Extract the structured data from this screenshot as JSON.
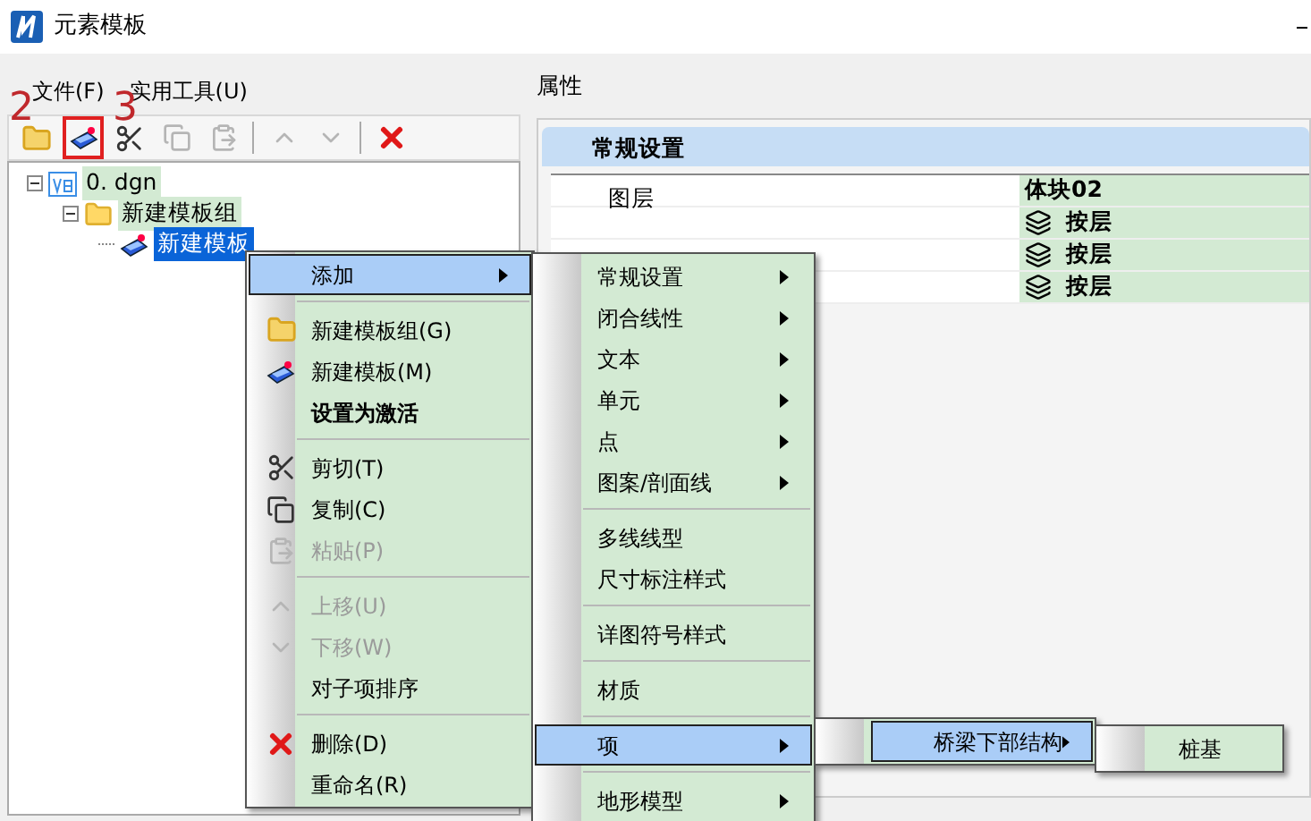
{
  "window": {
    "title": "元素模板"
  },
  "menu_bar": [
    "文件(F)",
    "实用工具(U)"
  ],
  "toolbar": [
    {
      "kind": "folder-add",
      "disabled": false,
      "highlighted": false
    },
    {
      "kind": "template",
      "disabled": false,
      "highlighted": true
    },
    {
      "kind": "cut",
      "disabled": false,
      "highlighted": false
    },
    {
      "kind": "copy",
      "disabled": true,
      "highlighted": false
    },
    {
      "kind": "paste",
      "disabled": true,
      "highlighted": false
    },
    {
      "kind": "separator"
    },
    {
      "kind": "up",
      "disabled": true,
      "highlighted": false
    },
    {
      "kind": "down",
      "disabled": true,
      "highlighted": false
    },
    {
      "kind": "separator"
    },
    {
      "kind": "delete",
      "disabled": false,
      "highlighted": false
    }
  ],
  "annotations": [
    {
      "label": "2"
    },
    {
      "label": "3"
    }
  ],
  "tree": [
    {
      "label": "0. dgn",
      "kind": "file",
      "expanded": true,
      "selected": false,
      "children": [
        {
          "label": "新建模板组",
          "kind": "folder",
          "expanded": true,
          "selected": false,
          "children": [
            {
              "label": "新建模板",
              "kind": "template",
              "selected": true
            }
          ]
        }
      ]
    }
  ],
  "properties": {
    "title": "属性",
    "section": "常规设置",
    "rows": [
      {
        "name": "图层",
        "value": "体块02",
        "kind": "text"
      },
      {
        "value": "按层",
        "kind": "layer"
      },
      {
        "value": "按层",
        "kind": "layer"
      },
      {
        "value": "按层",
        "kind": "layer"
      }
    ]
  },
  "context_menu": [
    {
      "kind": "item",
      "label": "添加",
      "submenu": true,
      "selected": true,
      "disabled": false,
      "bold": false
    },
    {
      "kind": "separator"
    },
    {
      "kind": "item",
      "label": "新建模板组(G)",
      "submenu": false,
      "selected": false,
      "disabled": false,
      "bold": false
    },
    {
      "kind": "item",
      "label": "新建模板(M)",
      "submenu": false,
      "selected": false,
      "disabled": false,
      "bold": false
    },
    {
      "kind": "item",
      "label": "设置为激活",
      "submenu": false,
      "selected": false,
      "disabled": false,
      "bold": true
    },
    {
      "kind": "separator"
    },
    {
      "kind": "item",
      "label": "剪切(T)",
      "submenu": false,
      "selected": false,
      "disabled": false,
      "bold": false
    },
    {
      "kind": "item",
      "label": "复制(C)",
      "submenu": false,
      "selected": false,
      "disabled": false,
      "bold": false
    },
    {
      "kind": "item",
      "label": "粘贴(P)",
      "submenu": false,
      "selected": false,
      "disabled": true,
      "bold": false
    },
    {
      "kind": "separator"
    },
    {
      "kind": "item",
      "label": "上移(U)",
      "submenu": false,
      "selected": false,
      "disabled": true,
      "bold": false
    },
    {
      "kind": "item",
      "label": "下移(W)",
      "submenu": false,
      "selected": false,
      "disabled": true,
      "bold": false
    },
    {
      "kind": "item",
      "label": "对子项排序",
      "submenu": false,
      "selected": false,
      "disabled": false,
      "bold": false
    },
    {
      "kind": "separator"
    },
    {
      "kind": "item",
      "label": "删除(D)",
      "submenu": false,
      "selected": false,
      "disabled": false,
      "bold": false
    },
    {
      "kind": "item",
      "label": "重命名(R)",
      "submenu": false,
      "selected": false,
      "disabled": false,
      "bold": false
    }
  ],
  "add_submenu": [
    {
      "kind": "item",
      "label": "常规设置",
      "submenu": true,
      "selected": false
    },
    {
      "kind": "item",
      "label": "闭合线性",
      "submenu": true,
      "selected": false
    },
    {
      "kind": "item",
      "label": "文本",
      "submenu": true,
      "selected": false
    },
    {
      "kind": "item",
      "label": "单元",
      "submenu": true,
      "selected": false
    },
    {
      "kind": "item",
      "label": "点",
      "submenu": true,
      "selected": false
    },
    {
      "kind": "item",
      "label": "图案/剖面线",
      "submenu": true,
      "selected": false
    },
    {
      "kind": "separator"
    },
    {
      "kind": "item",
      "label": "多线线型",
      "submenu": false,
      "selected": false
    },
    {
      "kind": "item",
      "label": "尺寸标注样式",
      "submenu": false,
      "selected": false
    },
    {
      "kind": "separator"
    },
    {
      "kind": "item",
      "label": "详图符号样式",
      "submenu": false,
      "selected": false
    },
    {
      "kind": "separator"
    },
    {
      "kind": "item",
      "label": "材质",
      "submenu": false,
      "selected": false
    },
    {
      "kind": "separator"
    },
    {
      "kind": "item",
      "label": "项",
      "submenu": true,
      "selected": true
    },
    {
      "kind": "separator"
    },
    {
      "kind": "item",
      "label": "地形模型",
      "submenu": true,
      "selected": false
    }
  ],
  "item_submenu": [
    {
      "kind": "item",
      "label": "桥梁下部结构",
      "submenu": true,
      "selected": true
    }
  ],
  "bridge_submenu": [
    {
      "kind": "item",
      "label": "桩基",
      "submenu": false,
      "selected": false
    }
  ]
}
